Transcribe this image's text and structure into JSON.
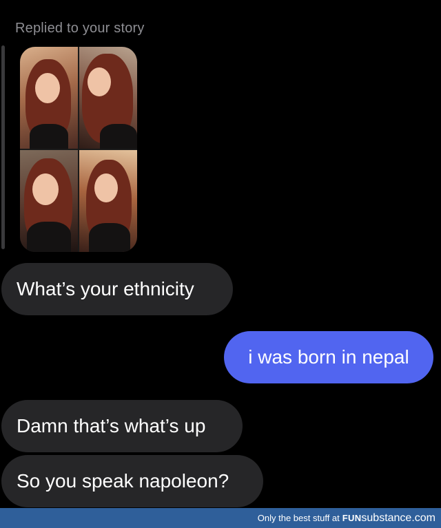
{
  "chat": {
    "reply_label": "Replied to your story",
    "messages": [
      {
        "side": "incoming",
        "text": "What’s your ethnicity"
      },
      {
        "side": "outgoing",
        "text": "i was born in nepal"
      },
      {
        "side": "incoming",
        "text": "Damn that’s what’s up"
      },
      {
        "side": "incoming",
        "text": "So you speak napoleon?"
      }
    ]
  },
  "footer": {
    "tagline": "Only the best stuff at",
    "brand_fun": "FUN",
    "brand_rest": "substance.com"
  },
  "colors": {
    "background": "#000000",
    "incoming_bubble": "#262628",
    "outgoing_bubble": "#5165f0",
    "reply_label": "#8e8e93",
    "footer_bar": "#2f5f9a"
  }
}
